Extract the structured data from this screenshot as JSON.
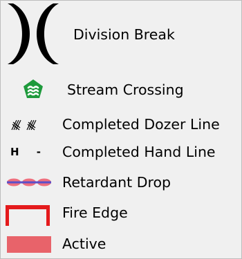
{
  "legend": {
    "items": [
      {
        "label": "Division Break",
        "icon": "division-break-icon"
      },
      {
        "label": "Stream Crossing",
        "icon": "stream-crossing-icon"
      },
      {
        "label": "Completed Dozer Line",
        "icon": "dozer-line-icon"
      },
      {
        "label": "Completed Hand Line",
        "icon": "hand-line-icon"
      },
      {
        "label": "Retardant Drop",
        "icon": "retardant-drop-icon"
      },
      {
        "label": "Fire Edge",
        "icon": "fire-edge-icon"
      },
      {
        "label": "Active",
        "icon": "active-swatch-icon"
      }
    ],
    "hand_line_symbol": "H -",
    "colors": {
      "background": "#f0f0f0",
      "stream_green": "#1e9a3c",
      "retardant_blue": "#5b4fc9",
      "retardant_pink": "#ef6f7e",
      "fire_red": "#e41a1c",
      "active_fill": "#e8636a"
    }
  }
}
